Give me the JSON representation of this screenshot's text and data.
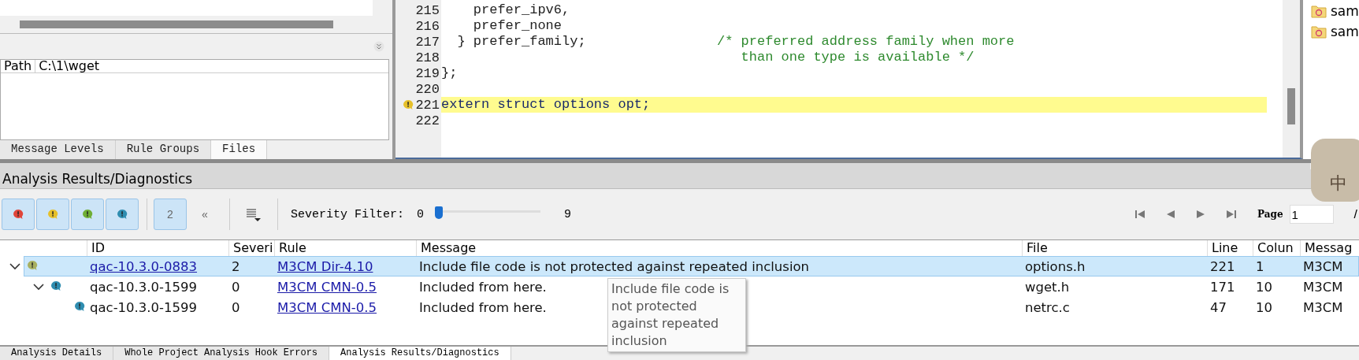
{
  "files_panel": {
    "path_label": "Path",
    "path_value": "C:\\1\\wget",
    "tabs": [
      {
        "label": "Message Levels",
        "selected": false
      },
      {
        "label": "Rule Groups",
        "selected": false
      },
      {
        "label": "Files",
        "selected": true
      }
    ]
  },
  "editor": {
    "lines": [
      {
        "number": "215",
        "code": "    prefer_ipv6,",
        "warning": false
      },
      {
        "number": "216",
        "code": "    prefer_none",
        "warning": false
      },
      {
        "number": "217",
        "code": "  } prefer_family;",
        "comment": "/* preferred address family when more",
        "warning": false
      },
      {
        "number": "218",
        "comment": "   than one type is available */",
        "warning": false
      },
      {
        "number": "219",
        "code": "};",
        "warning": false
      },
      {
        "number": "220",
        "warning": false
      },
      {
        "number": "221",
        "code": "extern struct options opt;",
        "warning": true
      },
      {
        "number": "222",
        "warning": false
      }
    ]
  },
  "project_panel": {
    "items": [
      {
        "label": "sam"
      },
      {
        "label": "sam"
      }
    ]
  },
  "ime_badge": {
    "label": "中"
  },
  "diagnostics": {
    "title": "Analysis Results/Diagnostics",
    "toolbar": {
      "filters": [
        {
          "color": "#e0453a",
          "pressed": true
        },
        {
          "color": "#e6c02a",
          "pressed": true
        },
        {
          "color": "#6fae35",
          "pressed": true
        },
        {
          "color": "#2f8db0",
          "pressed": true
        }
      ],
      "count_button": {
        "label": "2",
        "pressed": true
      },
      "collapse_label": "«",
      "severity_label": "Severity Filter:",
      "severity_min": "0",
      "severity_max": "9",
      "level": 0,
      "page_label": "Page",
      "page_value": "1",
      "page_separator": "/"
    },
    "columns": [
      "ID",
      "Severi",
      "Rule",
      "Message",
      "File",
      "Line",
      "Colun",
      "Messag"
    ],
    "rows": [
      {
        "id": "qac-10.3.0-0883",
        "severity": "2",
        "rule": "M3CM Dir-4.10",
        "message": "Include file code is not protected against repeated inclusion",
        "file": "options.h",
        "line": "221",
        "column": "1",
        "column_8": "M3CM",
        "color": "#a8b060",
        "selected": true,
        "expanded": true,
        "children": [
          {
            "id": "qac-10.3.0-1599",
            "severity": "0",
            "rule": "M3CM CMN-0.5",
            "message": "Included from here.",
            "file": "wget.h",
            "line": "171",
            "column": "10",
            "column_8": "M3CM",
            "color": "#2f8db0",
            "selected": false,
            "expanded": true,
            "children": [
              {
                "id": "qac-10.3.0-1599",
                "severity": "0",
                "rule": "M3CM CMN-0.5",
                "message": "Included from here.",
                "file": "netrc.c",
                "line": "47",
                "column": "10",
                "column_8": "M3CM",
                "color": "#2f8db0",
                "selected": false
              }
            ]
          }
        ]
      }
    ],
    "tooltip": "Include file code is not protected against repeated inclusion",
    "bottom_tabs": [
      {
        "label": "Analysis Details",
        "selected": false
      },
      {
        "label": "Whole Project Analysis Hook Errors",
        "selected": false
      },
      {
        "label": "Analysis Results/Diagnostics",
        "selected": true
      }
    ]
  }
}
